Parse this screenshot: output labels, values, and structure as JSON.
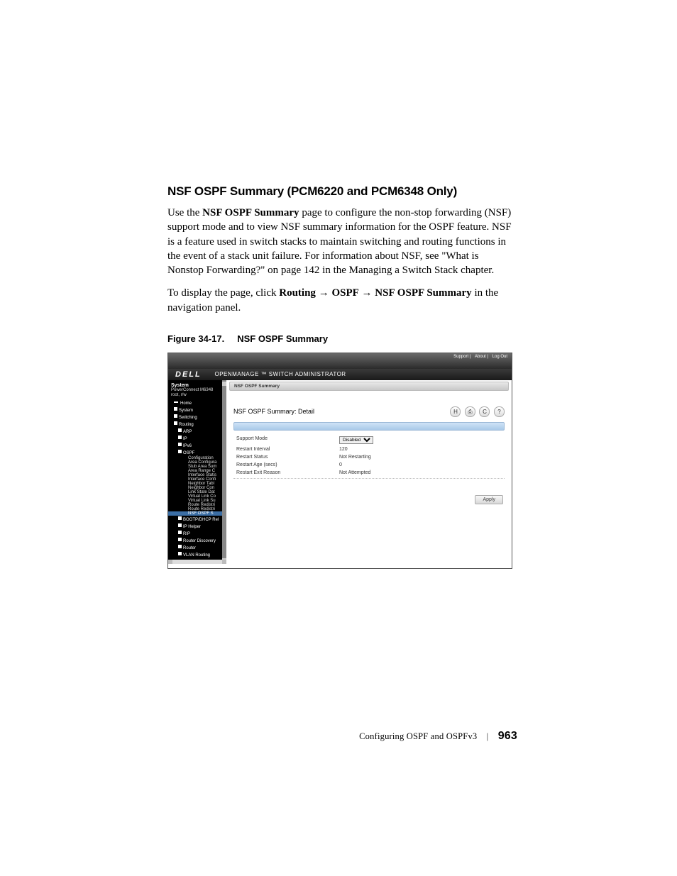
{
  "heading": "NSF OSPF Summary (PCM6220 and PCM6348 Only)",
  "para1_a": "Use the ",
  "para1_bold": "NSF OSPF Summary",
  "para1_b": " page to configure the non-stop forwarding (NSF) support mode and to view NSF summary information for the OSPF feature. NSF is a feature used in switch stacks to maintain switching and routing functions in the event of a stack unit failure. For information about NSF, see \"What is Nonstop Forwarding?\" on page 142 in the Managing a Switch Stack chapter.",
  "para2_a": "To display the page, click ",
  "para2_b1": "Routing",
  "para2_arrow": " → ",
  "para2_b2": "OSPF",
  "para2_b3": "NSF OSPF Summary",
  "para2_c": " in the navigation panel.",
  "figcap_a": "Figure 34-17.",
  "figcap_b": "NSF OSPF Summary",
  "header_links": {
    "a": "Support",
    "b": "About",
    "c": "Log Out"
  },
  "brand": {
    "logo": "DELL",
    "product": "OPENMANAGE ™  SWITCH  ADMINISTRATOR"
  },
  "nav": {
    "system": "System",
    "model": "PowerConnect M6348",
    "user": "root, r/w",
    "home": "Home",
    "n_system": "System",
    "n_switching": "Switching",
    "n_routing": "Routing",
    "arp": "ARP",
    "ip": "IP",
    "ipv6": "IPv6",
    "ospf": "OSPF",
    "ospf_items": [
      "Configuration",
      "Area Configura",
      "Stub Area Sum",
      "Area Range C",
      "Interface Statis",
      "Interface Confi",
      "Neighbor Tabl",
      "Neighbor Con",
      "Link State Dat",
      "Virtual Link Co",
      "Virtual Link Su",
      "Route Redistri",
      "Route Redistri"
    ],
    "ospf_selected": "NSF OSPF S",
    "bootp": "BOOTP/DHCP Rel",
    "iphelper": "IP Helper",
    "rip": "RIP",
    "rdisc": "Router Discovery",
    "router": "Router",
    "vlan": "VLAN Routing"
  },
  "breadcrumb": "NSF OSPF Summary",
  "detail_title": "NSF OSPF Summary: Detail",
  "icons": {
    "save": "H",
    "print": "⎙",
    "refresh": "C",
    "help": "?"
  },
  "fields": {
    "support_mode": {
      "label": "Support Mode",
      "value": "Disabled"
    },
    "restart_interval": {
      "label": "Restart Interval",
      "value": "120"
    },
    "restart_status": {
      "label": "Restart Status",
      "value": "Not Restarting"
    },
    "restart_age": {
      "label": "Restart Age (secs)",
      "value": "0"
    },
    "restart_exit": {
      "label": "Restart Exit Reason",
      "value": "Not Attempted"
    }
  },
  "apply": "Apply",
  "footer": {
    "title": "Configuring OSPF and OSPFv3",
    "page": "963"
  }
}
